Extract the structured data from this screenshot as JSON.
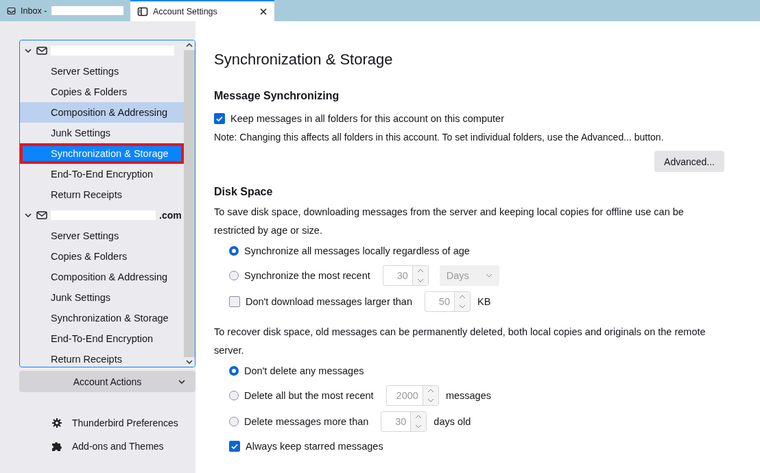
{
  "tabs": [
    {
      "kind": "inbox",
      "label": "Inbox -",
      "selected": false,
      "redacted": true
    },
    {
      "kind": "settings",
      "label": "Account Settings",
      "selected": true,
      "redacted": false
    }
  ],
  "accounts": [
    {
      "redacted": true,
      "expanded": true,
      "items": [
        {
          "label": "Server Settings",
          "selected": false,
          "hovered": false,
          "annotated": false
        },
        {
          "label": "Copies & Folders",
          "selected": false,
          "hovered": false,
          "annotated": false
        },
        {
          "label": "Composition & Addressing",
          "selected": false,
          "hovered": true,
          "annotated": false
        },
        {
          "label": "Junk Settings",
          "selected": false,
          "hovered": false,
          "annotated": false
        },
        {
          "label": "Synchronization & Storage",
          "selected": true,
          "hovered": false,
          "annotated": true
        },
        {
          "label": "End-To-End Encryption",
          "selected": false,
          "hovered": false,
          "annotated": false
        },
        {
          "label": "Return Receipts",
          "selected": false,
          "hovered": false,
          "annotated": false
        }
      ]
    },
    {
      "name": ".com",
      "redacted": true,
      "expanded": true,
      "items": [
        {
          "label": "Server Settings",
          "selected": false,
          "hovered": false,
          "annotated": false
        },
        {
          "label": "Copies & Folders",
          "selected": false,
          "hovered": false,
          "annotated": false
        },
        {
          "label": "Composition & Addressing",
          "selected": false,
          "hovered": false,
          "annotated": false
        },
        {
          "label": "Junk Settings",
          "selected": false,
          "hovered": false,
          "annotated": false
        },
        {
          "label": "Synchronization & Storage",
          "selected": false,
          "hovered": false,
          "annotated": false
        },
        {
          "label": "End-To-End Encryption",
          "selected": false,
          "hovered": false,
          "annotated": false
        },
        {
          "label": "Return Receipts",
          "selected": false,
          "hovered": false,
          "annotated": false
        }
      ]
    }
  ],
  "account_actions": {
    "label": "Account Actions"
  },
  "footer_links": [
    {
      "kind": "gear",
      "label": "Thunderbird Preferences"
    },
    {
      "kind": "puzzle",
      "label": "Add-ons and Themes"
    }
  ],
  "page_title": "Synchronization & Storage",
  "sync_section": {
    "heading": "Message Synchronizing",
    "checkbox": {
      "label": "Keep messages in all folders for this account on this computer",
      "checked": true
    },
    "note": "Note: Changing this affects all folders in this account. To set individual folders, use the Advanced... button.",
    "button": "Advanced..."
  },
  "disk_section": {
    "heading": "Disk Space",
    "description": "To save disk space, downloading messages from the server and keeping local copies for offline use can be restricted by age or size.",
    "options": [
      {
        "kind": "radio",
        "label": "Synchronize all messages locally regardless of age",
        "selected": true
      },
      {
        "kind": "radio",
        "label": "Synchronize the most recent",
        "selected": false,
        "value": "30",
        "dropdown": "Days"
      },
      {
        "kind": "checkbox",
        "label": "Don't download messages larger than",
        "checked": false,
        "value": "50",
        "unit": "KB"
      }
    ],
    "recover_description": "To recover disk space, old messages can be permanently deleted, both local copies and originals on the remote server.",
    "delete_options": [
      {
        "kind": "radio",
        "label": "Don't delete any messages",
        "selected": true
      },
      {
        "kind": "radio",
        "label": "Delete all but the most recent",
        "selected": false,
        "value": "2000",
        "unit": "messages"
      },
      {
        "kind": "radio",
        "label": "Delete messages more than",
        "selected": false,
        "value": "30",
        "unit": "days old"
      },
      {
        "kind": "checkbox",
        "label": "Always keep starred messages",
        "checked": true
      }
    ]
  }
}
